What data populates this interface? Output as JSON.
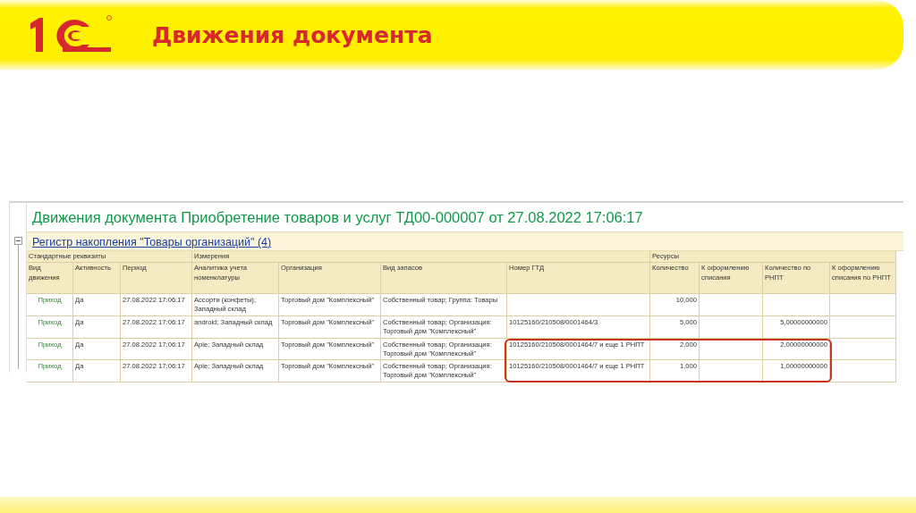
{
  "slide": {
    "title": "Движения документа"
  },
  "report": {
    "title": "Движения документа Приобретение товаров и услуг ТД00-000007 от 27.08.2022 17:06:17",
    "register": {
      "label": "Регистр накопления \"Товары организаций\" (4)",
      "expanded": true
    },
    "column_groups": [
      {
        "label": "Стандартные реквизиты",
        "columns": [
          "Вид движения",
          "Активность",
          "Период"
        ]
      },
      {
        "label": "Измерения",
        "columns": [
          "Аналитика учета номенклатуры",
          "Организация",
          "Вид запасов",
          "Номер ГТД"
        ]
      },
      {
        "label": "Ресурсы",
        "columns": [
          "Количество",
          "К оформлению списания",
          "Количество по РНПТ",
          "К оформлению списания по РНПТ"
        ]
      }
    ],
    "rows": [
      {
        "movement": "Приход",
        "active": "Да",
        "period": "27.08.2022 17:06:17",
        "analytics": "Ассорти (конфеты); Западный склад",
        "organization": "Торговый дом \"Комплексный\"",
        "stock_type": "Собственный товар; Группа: Товары",
        "quantity": "10,000",
        "highlighted": false
      },
      {
        "movement": "Приход",
        "active": "Да",
        "period": "27.08.2022 17:06:17",
        "analytics": "android; Западный склад",
        "organization": "Торговый дом \"Комплексный\"",
        "stock_type": "Собственный товар; Организация: Торговый дом \"Комплексный\"",
        "gtd": "10125160/210508/0001464/3",
        "quantity": "5,000",
        "quantity_rnpt": "5,00000000000",
        "highlighted": false
      },
      {
        "movement": "Приход",
        "active": "Да",
        "period": "27.08.2022 17:06:17",
        "analytics": "Aple; Западный склад",
        "organization": "Торговый дом \"Комплексный\"",
        "stock_type": "Собственный товар; Организация: Торговый дом \"Комплексный\"",
        "gtd": "10125160/210508/0001464/7 и еще 1 РНПТ",
        "quantity": "2,000",
        "quantity_rnpt": "2,00000000000",
        "highlighted": true
      },
      {
        "movement": "Приход",
        "active": "Да",
        "period": "27.08.2022 17:06:17",
        "analytics": "Aple; Западный склад",
        "organization": "Торговый дом \"Комплексный\"",
        "stock_type": "Собственный товар; Организация: Торговый дом \"Комплексный\"",
        "gtd": "10125160/210508/0001464/7 и еще 1 РНПТ",
        "quantity": "1,000",
        "quantity_rnpt": "1,00000000000",
        "highlighted": true
      }
    ]
  }
}
